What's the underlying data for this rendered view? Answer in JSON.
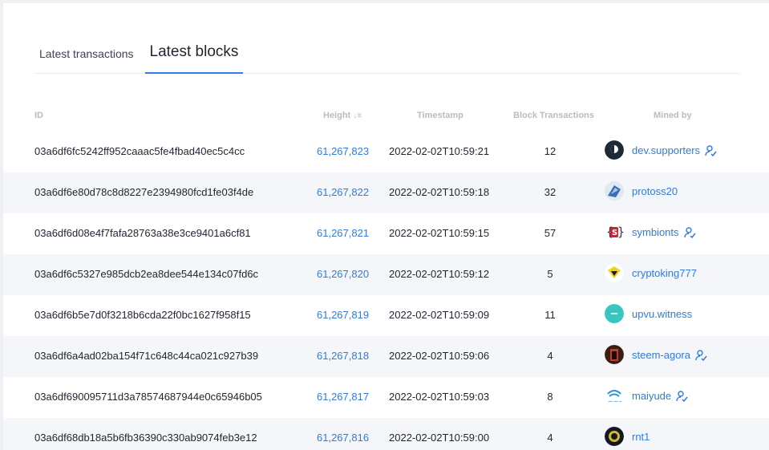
{
  "tabs": [
    {
      "label": "Latest transactions",
      "active": false
    },
    {
      "label": "Latest blocks",
      "active": true
    }
  ],
  "table": {
    "columns": {
      "id": "ID",
      "height": "Height",
      "timestamp": "Timestamp",
      "block_transactions": "Block Transactions",
      "mined_by": "Mined by"
    },
    "rows": [
      {
        "id": "03a6df6fc5242ff952caaac5fe4fbad40ec5c4cc",
        "height": "61,267,823",
        "timestamp": "2022-02-02T10:59:21",
        "tx": "12",
        "miner": "dev.supporters",
        "verified": true,
        "avatar_icon": "dark-circle-logo-icon"
      },
      {
        "id": "03a6df6e80d78c8d8227e2394980fcd1fe03f4de",
        "height": "61,267,822",
        "timestamp": "2022-02-02T10:59:18",
        "tx": "32",
        "miner": "protoss20",
        "verified": false,
        "avatar_icon": "protoss-avatar-icon"
      },
      {
        "id": "03a6df6d08e4f7fafa28763a38e3ce9401a6cf81",
        "height": "61,267,821",
        "timestamp": "2022-02-02T10:59:15",
        "tx": "57",
        "miner": "symbionts",
        "verified": true,
        "avatar_icon": "symbionts-logo-icon"
      },
      {
        "id": "03a6df6c5327e985dcb2ea8dee544e134c07fd6c",
        "height": "61,267,820",
        "timestamp": "2022-02-02T10:59:12",
        "tx": "5",
        "miner": "cryptoking777",
        "verified": false,
        "avatar_icon": "crown-logo-icon"
      },
      {
        "id": "03a6df6b5e7d0f3218b6cda22f0bc1627f958f15",
        "height": "61,267,819",
        "timestamp": "2022-02-02T10:59:09",
        "tx": "11",
        "miner": "upvu.witness",
        "verified": false,
        "avatar_icon": "upvu-logo-icon"
      },
      {
        "id": "03a6df6a4ad02ba154f71c648c44ca021c927b39",
        "height": "61,267,818",
        "timestamp": "2022-02-02T10:59:06",
        "tx": "4",
        "miner": "steem-agora",
        "verified": true,
        "avatar_icon": "steem-agora-avatar-icon"
      },
      {
        "id": "03a6df690095711d3a78574687944e0c65946b05",
        "height": "61,267,817",
        "timestamp": "2022-02-02T10:59:03",
        "tx": "8",
        "miner": "maiyude",
        "verified": true,
        "avatar_icon": "maiyude-logo-icon"
      },
      {
        "id": "03a6df68db18a5b6fb36390c330ab9074feb3e12",
        "height": "61,267,816",
        "timestamp": "2022-02-02T10:59:00",
        "tx": "4",
        "miner": "rnt1",
        "verified": false,
        "avatar_icon": "rnt1-avatar-icon"
      }
    ]
  },
  "colors": {
    "accent": "#2f7be0",
    "row_alt": "#f5f6f9",
    "header_text": "#b7bcc7"
  }
}
